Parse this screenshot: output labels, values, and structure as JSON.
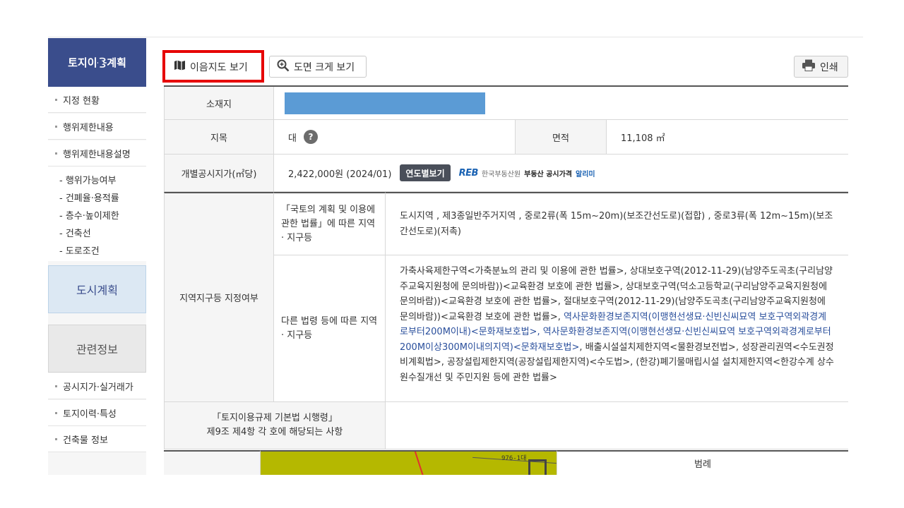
{
  "sidebar": {
    "header": "토지이용계획",
    "items_top": [
      "지정 현황",
      "행위제한내용",
      "행위제한내용설명"
    ],
    "sub_items": [
      "- 행위가능여부",
      "- 건폐율·용적률",
      "- 층수·높이제한",
      "- 건축선",
      "- 도로조건"
    ],
    "box_city": "도시계획",
    "box_related": "관련정보",
    "items_bottom": [
      "공시지가·실거래가",
      "토지이력·특성",
      "건축물 정보"
    ]
  },
  "toolbar": {
    "map_label": "이음지도 보기",
    "zoom_label": "도면 크게 보기",
    "print_label": "인쇄"
  },
  "table": {
    "location_label": "소재지",
    "category_label": "지목",
    "category_value": "대",
    "help_icon": "?",
    "area_label": "면적",
    "area_value": "11,108 ㎡",
    "price_label": "개별공시지가(㎡당)",
    "price_value": "2,422,000원 (2024/01)",
    "yearly_button": "연도별보기",
    "reb_logo": "REB",
    "reb_org": "한국부동산원",
    "reb_service": "부동산 공시가격",
    "reb_app": "알리미",
    "zone_label": "지역지구등 지정여부",
    "national_law_label": "「국토의 계획 및 이용에 관한 법률」에 따른 지역 · 지구등",
    "national_law_value": "도시지역 , 제3종일반주거지역 , 중로2류(폭 15m~20m)(보조간선도로)(접합) , 중로3류(폭 12m~15m)(보조간선도로)(저촉)",
    "other_law_label": "다른 법령 등에 따른 지역 · 지구등",
    "other_law_part1": "가축사육제한구역<가축분뇨의 관리 및 이용에 관한 법률>, 상대보호구역(2012-11-29)(남양주도곡초(구리남양주교육지원청에 문의바람))<교육환경 보호에 관한 법률>, 상대보호구역(덕소고등학교(구리남양주교육지원청에 문의바람))<교육환경 보호에 관한 법률>, 절대보호구역(2012-11-29)(남양주도곡초(구리남양주교육지원청에 문의바람))<교육환경 보호에 관한 법률>, ",
    "other_law_link": "역사문화환경보존지역(이맹현선생묘·신빈신씨묘역 보호구역외곽경계로부터200M이내)<문화재보호법>, 역사문화환경보존지역(이맹현선생묘·신빈신씨묘역 보호구역외곽경계로부터200M이상300M이내의지역)<문화재보호법>",
    "other_law_part2": ", 배출시설설치제한지역<물환경보전법>, 성장관리권역<수도권정비계획법>, 공장설립제한지역(공장설립제한지역)<수도법>, (한강)폐기물매립시설 설치제한지역<한강수계 상수원수질개선 및 주민지원 등에 관한 법률>",
    "decree_label_1": "「토지이용규제 기본법 시행령」",
    "decree_label_2": "제9조 제4항 각 호에 해당되는 사항",
    "decree_value": ""
  },
  "map": {
    "parcel_label": "976-1대",
    "legend_label": "범례"
  },
  "colors": {
    "sidebar_header": "#3a4d8c",
    "highlight_frame": "#e60000",
    "location_redaction": "#5b9bd5",
    "link_text": "#2a4f9c",
    "map_fill": "#b5b800"
  },
  "icons": {
    "map": "map-icon",
    "zoom": "zoom-in-icon",
    "print": "printer-icon"
  }
}
